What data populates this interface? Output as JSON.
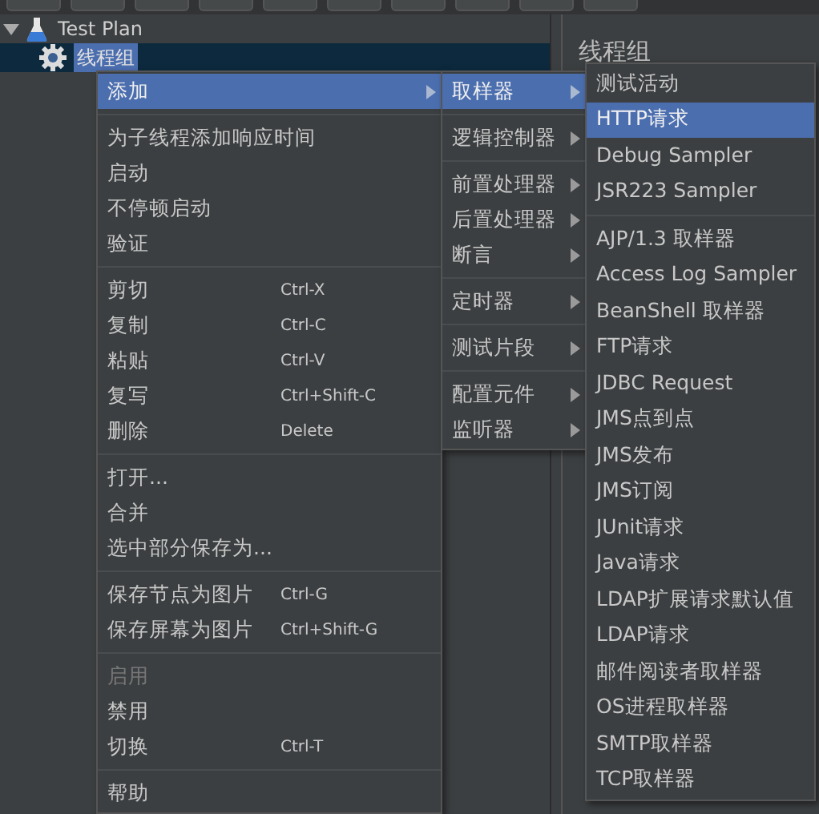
{
  "tree": [
    {
      "label": "Test Plan",
      "kind": "test-plan",
      "expanded": true,
      "selected": false,
      "children": [
        {
          "label": "线程组",
          "kind": "thread-group",
          "selected": true
        }
      ]
    }
  ],
  "panel": {
    "title": "线程组"
  },
  "menus": [
    {
      "groups": [
        [
          {
            "label": "添加",
            "submenu": true,
            "selected": true,
            "disabled": false
          }
        ],
        [
          {
            "label": "为子线程添加响应时间",
            "submenu": false,
            "selected": false,
            "disabled": false
          },
          {
            "label": "启动",
            "submenu": false,
            "selected": false,
            "disabled": false
          },
          {
            "label": "不停顿启动",
            "submenu": false,
            "selected": false,
            "disabled": false
          },
          {
            "label": "验证",
            "submenu": false,
            "selected": false,
            "disabled": false
          }
        ],
        [
          {
            "label": "剪切",
            "shortcut": "Ctrl-X",
            "submenu": false,
            "selected": false,
            "disabled": false
          },
          {
            "label": "复制",
            "shortcut": "Ctrl-C",
            "submenu": false,
            "selected": false,
            "disabled": false
          },
          {
            "label": "粘贴",
            "shortcut": "Ctrl-V",
            "submenu": false,
            "selected": false,
            "disabled": false
          },
          {
            "label": "复写",
            "shortcut": "Ctrl+Shift-C",
            "submenu": false,
            "selected": false,
            "disabled": false
          },
          {
            "label": "删除",
            "shortcut": "Delete",
            "submenu": false,
            "selected": false,
            "disabled": false
          }
        ],
        [
          {
            "label": "打开...",
            "submenu": false,
            "selected": false,
            "disabled": false
          },
          {
            "label": "合并",
            "submenu": false,
            "selected": false,
            "disabled": false
          },
          {
            "label": "选中部分保存为...",
            "submenu": false,
            "selected": false,
            "disabled": false
          }
        ],
        [
          {
            "label": "保存节点为图片",
            "shortcut": "Ctrl-G",
            "submenu": false,
            "selected": false,
            "disabled": false
          },
          {
            "label": "保存屏幕为图片",
            "shortcut": "Ctrl+Shift-G",
            "submenu": false,
            "selected": false,
            "disabled": false
          }
        ],
        [
          {
            "label": "启用",
            "submenu": false,
            "selected": false,
            "disabled": true
          },
          {
            "label": "禁用",
            "submenu": false,
            "selected": false,
            "disabled": false
          },
          {
            "label": "切换",
            "shortcut": "Ctrl-T",
            "submenu": false,
            "selected": false,
            "disabled": false
          }
        ],
        [
          {
            "label": "帮助",
            "submenu": false,
            "selected": false,
            "disabled": false
          }
        ]
      ]
    },
    {
      "groups": [
        [
          {
            "label": "取样器",
            "submenu": true,
            "selected": true,
            "disabled": false
          }
        ],
        [
          {
            "label": "逻辑控制器",
            "submenu": true,
            "selected": false,
            "disabled": false
          }
        ],
        [
          {
            "label": "前置处理器",
            "submenu": true,
            "selected": false,
            "disabled": false
          },
          {
            "label": "后置处理器",
            "submenu": true,
            "selected": false,
            "disabled": false
          },
          {
            "label": "断言",
            "submenu": true,
            "selected": false,
            "disabled": false
          }
        ],
        [
          {
            "label": "定时器",
            "submenu": true,
            "selected": false,
            "disabled": false
          }
        ],
        [
          {
            "label": "测试片段",
            "submenu": true,
            "selected": false,
            "disabled": false
          }
        ],
        [
          {
            "label": "配置元件",
            "submenu": true,
            "selected": false,
            "disabled": false
          },
          {
            "label": "监听器",
            "submenu": true,
            "selected": false,
            "disabled": false
          }
        ]
      ]
    },
    {
      "groups": [
        [
          {
            "label": "测试活动",
            "submenu": false,
            "selected": false,
            "disabled": false
          },
          {
            "label": "HTTP请求",
            "submenu": false,
            "selected": true,
            "disabled": false
          },
          {
            "label": "Debug Sampler",
            "submenu": false,
            "selected": false,
            "disabled": false
          },
          {
            "label": "JSR223 Sampler",
            "submenu": false,
            "selected": false,
            "disabled": false
          }
        ],
        [
          {
            "label": "AJP/1.3 取样器",
            "submenu": false,
            "selected": false,
            "disabled": false
          },
          {
            "label": "Access Log Sampler",
            "submenu": false,
            "selected": false,
            "disabled": false
          },
          {
            "label": "BeanShell 取样器",
            "submenu": false,
            "selected": false,
            "disabled": false
          },
          {
            "label": "FTP请求",
            "submenu": false,
            "selected": false,
            "disabled": false
          },
          {
            "label": "JDBC Request",
            "submenu": false,
            "selected": false,
            "disabled": false
          },
          {
            "label": "JMS点到点",
            "submenu": false,
            "selected": false,
            "disabled": false
          },
          {
            "label": "JMS发布",
            "submenu": false,
            "selected": false,
            "disabled": false
          },
          {
            "label": "JMS订阅",
            "submenu": false,
            "selected": false,
            "disabled": false
          },
          {
            "label": "JUnit请求",
            "submenu": false,
            "selected": false,
            "disabled": false
          },
          {
            "label": "Java请求",
            "submenu": false,
            "selected": false,
            "disabled": false
          },
          {
            "label": "LDAP扩展请求默认值",
            "submenu": false,
            "selected": false,
            "disabled": false
          },
          {
            "label": "LDAP请求",
            "submenu": false,
            "selected": false,
            "disabled": false
          },
          {
            "label": "邮件阅读者取样器",
            "submenu": false,
            "selected": false,
            "disabled": false
          },
          {
            "label": "OS进程取样器",
            "submenu": false,
            "selected": false,
            "disabled": false
          },
          {
            "label": "SMTP取样器",
            "submenu": false,
            "selected": false,
            "disabled": false
          },
          {
            "label": "TCP取样器",
            "submenu": false,
            "selected": false,
            "disabled": false
          }
        ]
      ]
    }
  ]
}
